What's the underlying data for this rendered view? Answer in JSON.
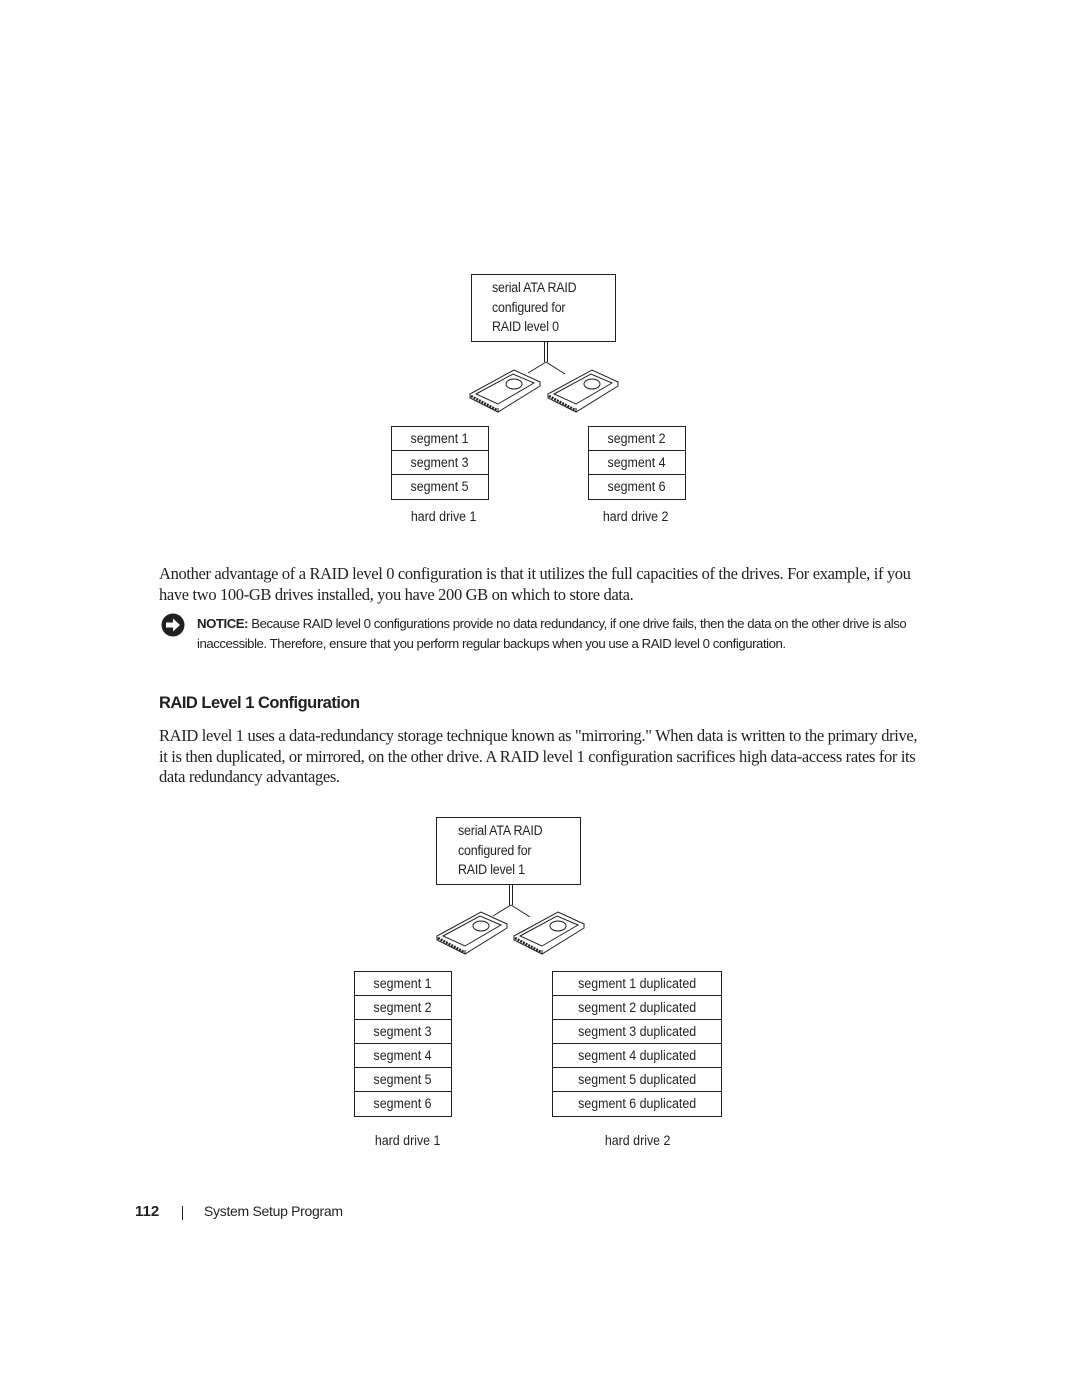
{
  "diagram_raid0": {
    "controller_lines": [
      "serial ATA RAID",
      "configured for",
      "RAID level 0"
    ],
    "drive1": {
      "segments": [
        "segment 1",
        "segment 3",
        "segment 5"
      ],
      "label": "hard drive 1"
    },
    "drive2": {
      "segments": [
        "segment 2",
        "segment 4",
        "segment 6"
      ],
      "label": "hard drive 2"
    }
  },
  "paragraph_raid0": "Another advantage of a RAID level 0 configuration is that it utilizes the full capacities of the drives. For example, if you have two 100-GB drives installed, you have 200 GB on which to store data.",
  "notice": {
    "icon": "notice-arrow-icon",
    "label": "NOTICE:",
    "text": " Because RAID level 0 configurations provide no data redundancy, if one drive fails, then the data on the other drive is also inaccessible. Therefore, ensure that you perform regular backups when you use a RAID level 0 configuration."
  },
  "heading_raid1": "RAID Level 1 Configuration",
  "paragraph_raid1": "RAID level 1 uses a data-redundancy storage technique known as \"mirroring.\" When data is written to the primary drive, it is then duplicated, or mirrored, on the other drive. A RAID level 1 configuration sacrifices high data-access rates for its data redundancy advantages.",
  "diagram_raid1": {
    "controller_lines": [
      "serial ATA RAID",
      "configured for",
      "RAID level 1"
    ],
    "drive1": {
      "segments": [
        "segment 1",
        "segment 2",
        "segment 3",
        "segment 4",
        "segment 5",
        "segment 6"
      ],
      "label": "hard drive 1"
    },
    "drive2": {
      "segments": [
        "segment 1 duplicated",
        "segment 2 duplicated",
        "segment 3 duplicated",
        "segment 4 duplicated",
        "segment 5 duplicated",
        "segment 6 duplicated"
      ],
      "label": "hard drive 2"
    }
  },
  "footer": {
    "page_number": "112",
    "section_title": "System Setup Program"
  }
}
